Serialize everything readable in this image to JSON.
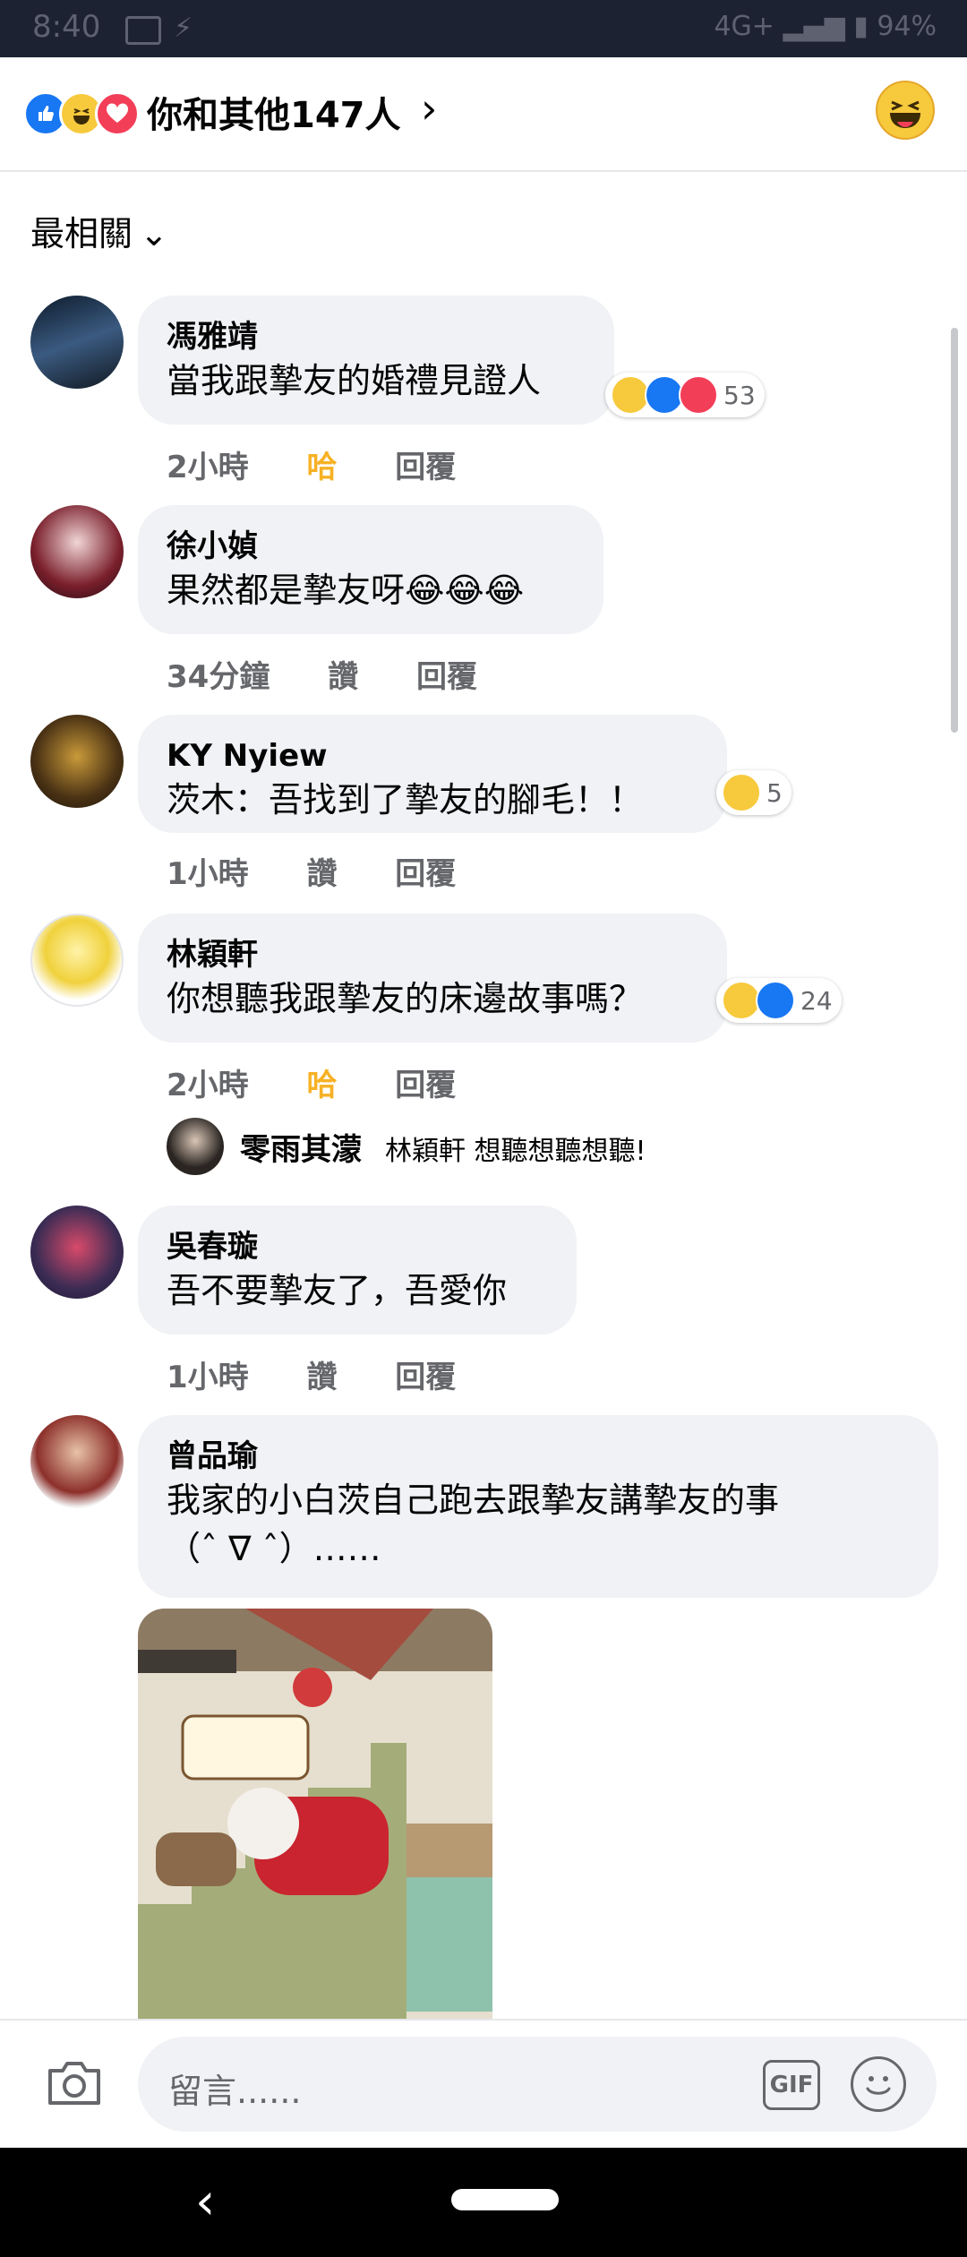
{
  "status": {
    "time": "8:40",
    "network": "4G+",
    "battery": "94%"
  },
  "header": {
    "reaction_count": "你和其他147人",
    "chevron": "›"
  },
  "sort": {
    "label": "最相關"
  },
  "comments": [
    {
      "name": "馮雅靖",
      "text": "當我跟摯友的婚禮見證人",
      "time": "2小時",
      "reaction": "哈",
      "reply": "回覆",
      "reaction_count": "53"
    },
    {
      "name": "徐小媜",
      "text": "果然都是摯友呀😂😂😂",
      "time": "34分鐘",
      "reaction": "讚",
      "reply": "回覆"
    },
    {
      "name": "KY Nyiew",
      "text": "茨木：吾找到了摯友的腳毛！！",
      "time": "1小時",
      "reaction": "讚",
      "reply": "回覆",
      "reaction_count": "5"
    },
    {
      "name": "林穎軒",
      "text": "你想聽我跟摯友的床邊故事嗎？",
      "time": "2小時",
      "reaction": "哈",
      "reply": "回覆",
      "reaction_count": "24"
    },
    {
      "name": "吳春璇",
      "text": "吾不要摯友了，吾愛你",
      "time": "1小時",
      "reaction": "讚",
      "reply": "回覆"
    },
    {
      "name": "曾品瑜",
      "text_line1": "我家的小白茨自己跑去跟摯友講摯友的事",
      "text_line2": "（ˆ ∇ ˆ）……"
    }
  ],
  "reply_preview": {
    "name": "零雨其濛",
    "text": "林穎軒 想聽想聽想聽!"
  },
  "composer": {
    "placeholder": "留言......",
    "gif": "GIF"
  },
  "colors": {
    "like": "#1877f2",
    "haha": "#f7c93c",
    "love": "#f33e58",
    "haha_text": "#f7b125"
  }
}
